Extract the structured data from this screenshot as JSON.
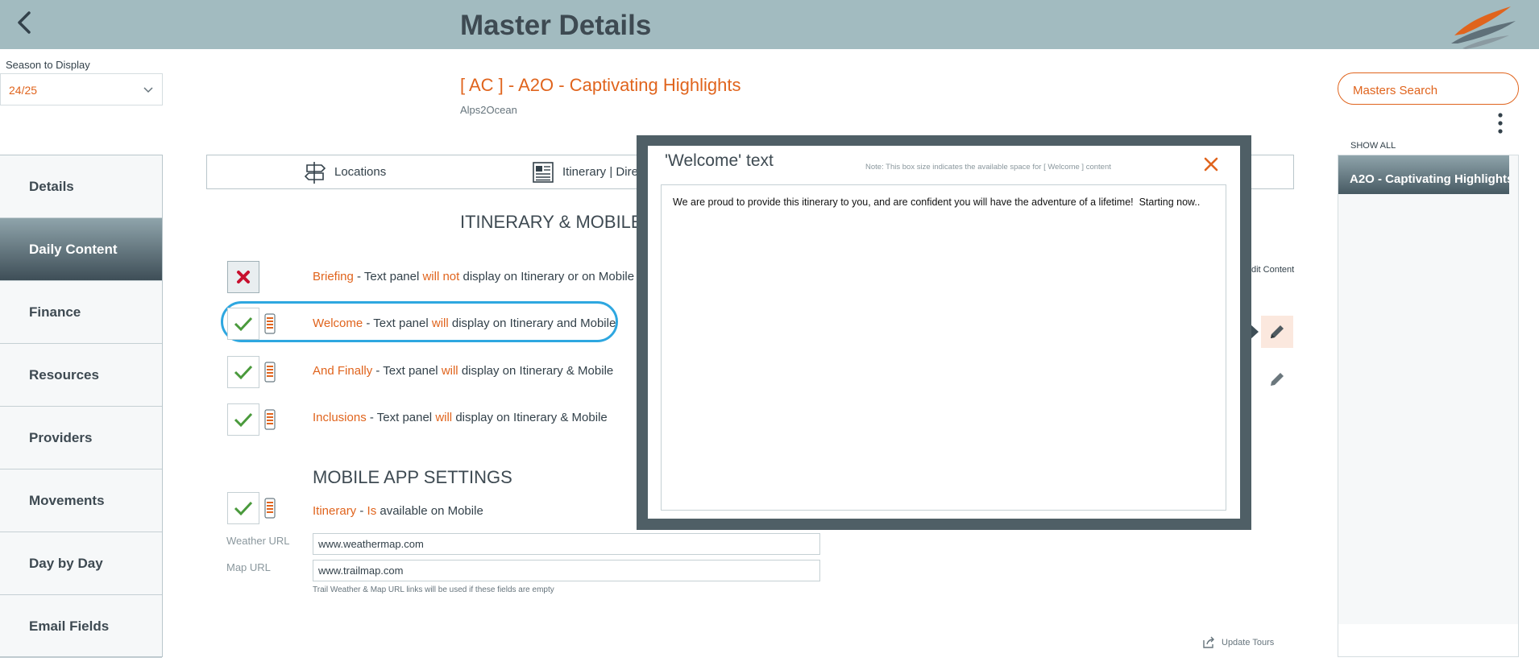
{
  "header": {
    "title": "Master Details"
  },
  "season": {
    "label": "Season to Display",
    "value": "24/25"
  },
  "tour": {
    "title": "[ AC ] - A2O - Captivating Highlights",
    "subtitle": "Alps2Ocean"
  },
  "search": {
    "label": "Masters Search"
  },
  "right_panel": {
    "show_all": "SHOW ALL",
    "active_item": "A2O - Captivating Highlights"
  },
  "sidebar": {
    "items": [
      {
        "label": "Details",
        "active": false
      },
      {
        "label": "Daily Content",
        "active": true
      },
      {
        "label": "Finance",
        "active": false
      },
      {
        "label": "Resources",
        "active": false
      },
      {
        "label": "Providers",
        "active": false
      },
      {
        "label": "Movements",
        "active": false
      },
      {
        "label": "Day by Day",
        "active": false
      },
      {
        "label": "Email Fields",
        "active": false
      }
    ]
  },
  "tabs": [
    {
      "label": "Locations",
      "icon": "signpost-icon"
    },
    {
      "label": "Itinerary | Direc",
      "icon": "newspaper-icon"
    }
  ],
  "section": {
    "heading": "ITINERARY & MOBILE",
    "edit_content": "dit Content"
  },
  "rows": [
    {
      "name": "Briefing",
      "mid": " - Text panel ",
      "flag": "will not",
      "rest": " display on Itinerary or on Mobile",
      "enabled": false
    },
    {
      "name": "Welcome",
      "mid": " - Text panel ",
      "flag": "will",
      "rest": " display on Itinerary and Mobile",
      "enabled": true
    },
    {
      "name": "And Finally",
      "mid": " - Text panel ",
      "flag": "will",
      "rest": " display on Itinerary  & Mobile",
      "enabled": true
    },
    {
      "name": "Inclusions",
      "mid": " - Text panel ",
      "flag": "will",
      "rest": " display on Itinerary  & Mobile",
      "enabled": true
    }
  ],
  "mobile": {
    "heading": "MOBILE APP SETTINGS",
    "row": {
      "name": "Itinerary",
      "mid": " - ",
      "flag": "Is",
      "rest": " available on Mobile"
    },
    "weather_label": "Weather URL",
    "weather_value": "www.weathermap.com",
    "map_label": "Map URL",
    "map_value": "www.trailmap.com",
    "hint": "Trail  Weather & Map URL links will be used if these fields are empty"
  },
  "update_tours": "Update Tours",
  "modal": {
    "title": "'Welcome' text",
    "note": "Note: This box size indicates the available space for [ Welcome ] content",
    "text": "We are proud to provide this itinerary to you, and are confident you will have the adventure of a lifetime!  Starting now.."
  },
  "colors": {
    "accent": "#e0641d",
    "header": "#a2bbc0",
    "highlight": "#2ea7e0",
    "check": "#4a9a3c",
    "cross": "#c8102e"
  }
}
